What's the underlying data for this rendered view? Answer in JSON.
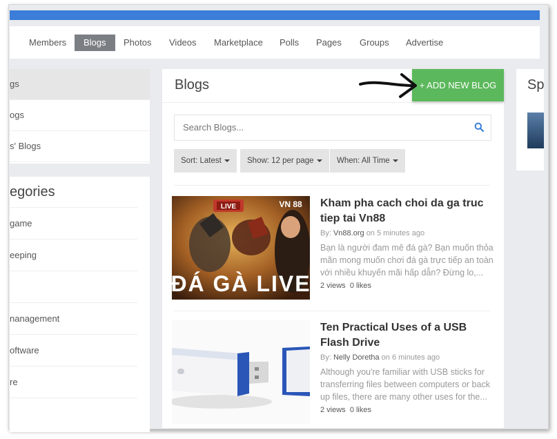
{
  "nav": {
    "items": [
      "Members",
      "Blogs",
      "Photos",
      "Videos",
      "Marketplace",
      "Polls",
      "Pages",
      "Groups",
      "Advertise"
    ],
    "active": "Blogs"
  },
  "sidebar": {
    "menu": [
      "gs",
      "ogs",
      "s' Blogs"
    ],
    "categories_title": "egories",
    "categories": [
      "game",
      "eeping",
      "",
      "nanagement",
      "oftware",
      "re"
    ]
  },
  "main": {
    "title": "Blogs",
    "add_button": "+ ADD NEW BLOG",
    "search_placeholder": "Search Blogs...",
    "filters": {
      "sort": "Sort: Latest",
      "show": "Show: 12 per page",
      "when": "When: All Time"
    },
    "posts": [
      {
        "title": "Kham pha cach choi da ga truc tiep tai Vn88",
        "by_label": "By:",
        "author": "Vn88.org",
        "time": "on 5 minutes ago",
        "excerpt": "Bạn là người đam mê đá gà? Bạn muốn thỏa mãn mong muốn chơi đá gà trực tiếp an toàn với nhiều khuyến mãi hấp dẫn? Đừng lo,...",
        "views": "2 views",
        "likes": "0 likes",
        "thumb_badge": "LIVE",
        "thumb_brand": "VN 88",
        "thumb_caption": "ĐÁ GÀ LIVE"
      },
      {
        "title": "Ten Practical Uses of a USB Flash Drive",
        "by_label": "By:",
        "author": "Nelly Doretha",
        "time": "on 6 minutes ago",
        "excerpt": "Although you're familiar with USB sticks for transferring files between computers or back up files, there are many other uses for the...",
        "views": "2 views",
        "likes": "0 likes"
      }
    ]
  },
  "right": {
    "title": "Sp"
  },
  "colors": {
    "topbar": "#3b7dd8",
    "add_button": "#5cb85c",
    "nav_active": "#7b7f84",
    "search_icon": "#3b7dd8"
  }
}
